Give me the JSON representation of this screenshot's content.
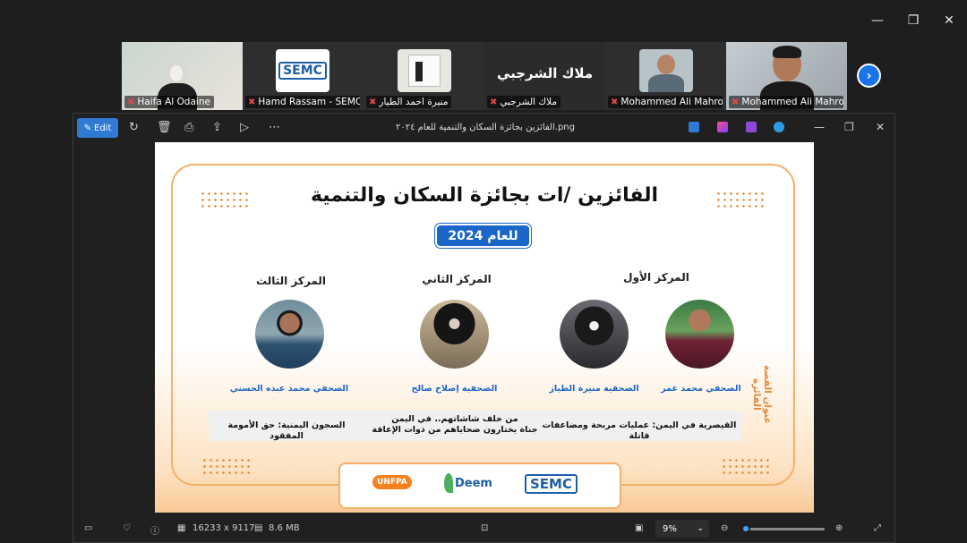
{
  "participants": [
    {
      "name": "Haifa Al Odaine"
    },
    {
      "name": "Hamd  Rassam - SEMC",
      "logo_text": "SEMC"
    },
    {
      "name": "منيرة احمد الطيار",
      "active": true
    },
    {
      "name": "ملاك الشرجبي",
      "display_name": "ملاك الشرجبي"
    },
    {
      "name": "Mohammed Ali Mahro..."
    },
    {
      "name": "Mohammed Ali Mahro..."
    }
  ],
  "next_icon": "chevron-right-icon",
  "window_controls": {
    "minimize": "—",
    "restore": "❐",
    "close": "✕"
  },
  "viewer": {
    "edit_label": "Edit",
    "file_title": "الفائزين بجائزة السكان والتنمية للعام ٢٠٢٤.png",
    "status": {
      "dimensions": "16233 x 9117",
      "size": "8.6 MB",
      "zoom": "9%"
    }
  },
  "poster": {
    "title": "الفائزين /ات بجائزة السكان والتنمية",
    "year_badge": "للعام 2024",
    "first_place": "المركز الأول",
    "second_place": "المركز الثاني",
    "third_place": "المركز الثالث",
    "cap_1": "الصحفي محمد عمر",
    "cap_2": "الصحفية منيرة الطيار",
    "cap_3": "الصحفية  إصلاح صالح",
    "cap_4": "الصحفي محمد عبده الحسني",
    "vertical_label": "عنوان القصة الفائزة",
    "story_1": "القيصرية في اليمن: عمليات مربحة ومضاعفات قاتلة",
    "story_2a": "من خلف شاشاتهم.. في اليمن",
    "story_2b": "جناة يختارون ضحاياهم من ذوات الإعاقة",
    "story_3": "السجون اليمنية: حق الأمومة المفقود",
    "logo_semc": "SEMC",
    "logo_deem": "Deem",
    "logo_unfpa": "UNFPA"
  }
}
